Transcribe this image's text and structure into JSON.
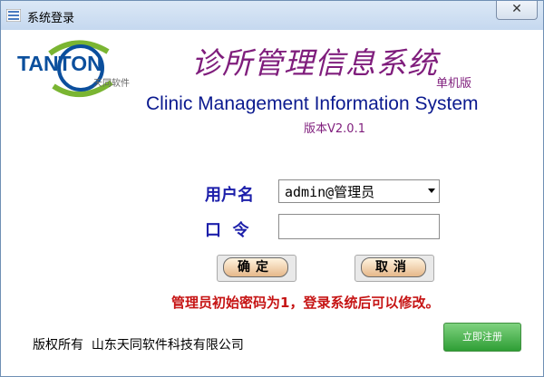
{
  "window": {
    "title": "系统登录",
    "close_symbol": "✕"
  },
  "logo": {
    "brand": "TANTON",
    "sub": "天同软件"
  },
  "header": {
    "title_cn": "诊所管理信息系统",
    "edition": "单机版",
    "title_en": "Clinic Management Information System",
    "version": "版本V2.0.1"
  },
  "form": {
    "username_label": "用户名",
    "username_value": "admin@管理员",
    "password_label": "口  令",
    "password_value": ""
  },
  "buttons": {
    "confirm": "确定",
    "cancel": "取消",
    "register": "立即注册"
  },
  "notice": "管理员初始密码为1，登录系统后可以修改。",
  "footer": {
    "copyright": "版权所有  山东天同软件科技有限公司"
  },
  "colors": {
    "brand_blue": "#0b4f9d",
    "title_purple": "#7f1d7c",
    "label_blue": "#1c1faa",
    "notice_red": "#c61414",
    "register_green": "#2e9e35"
  }
}
